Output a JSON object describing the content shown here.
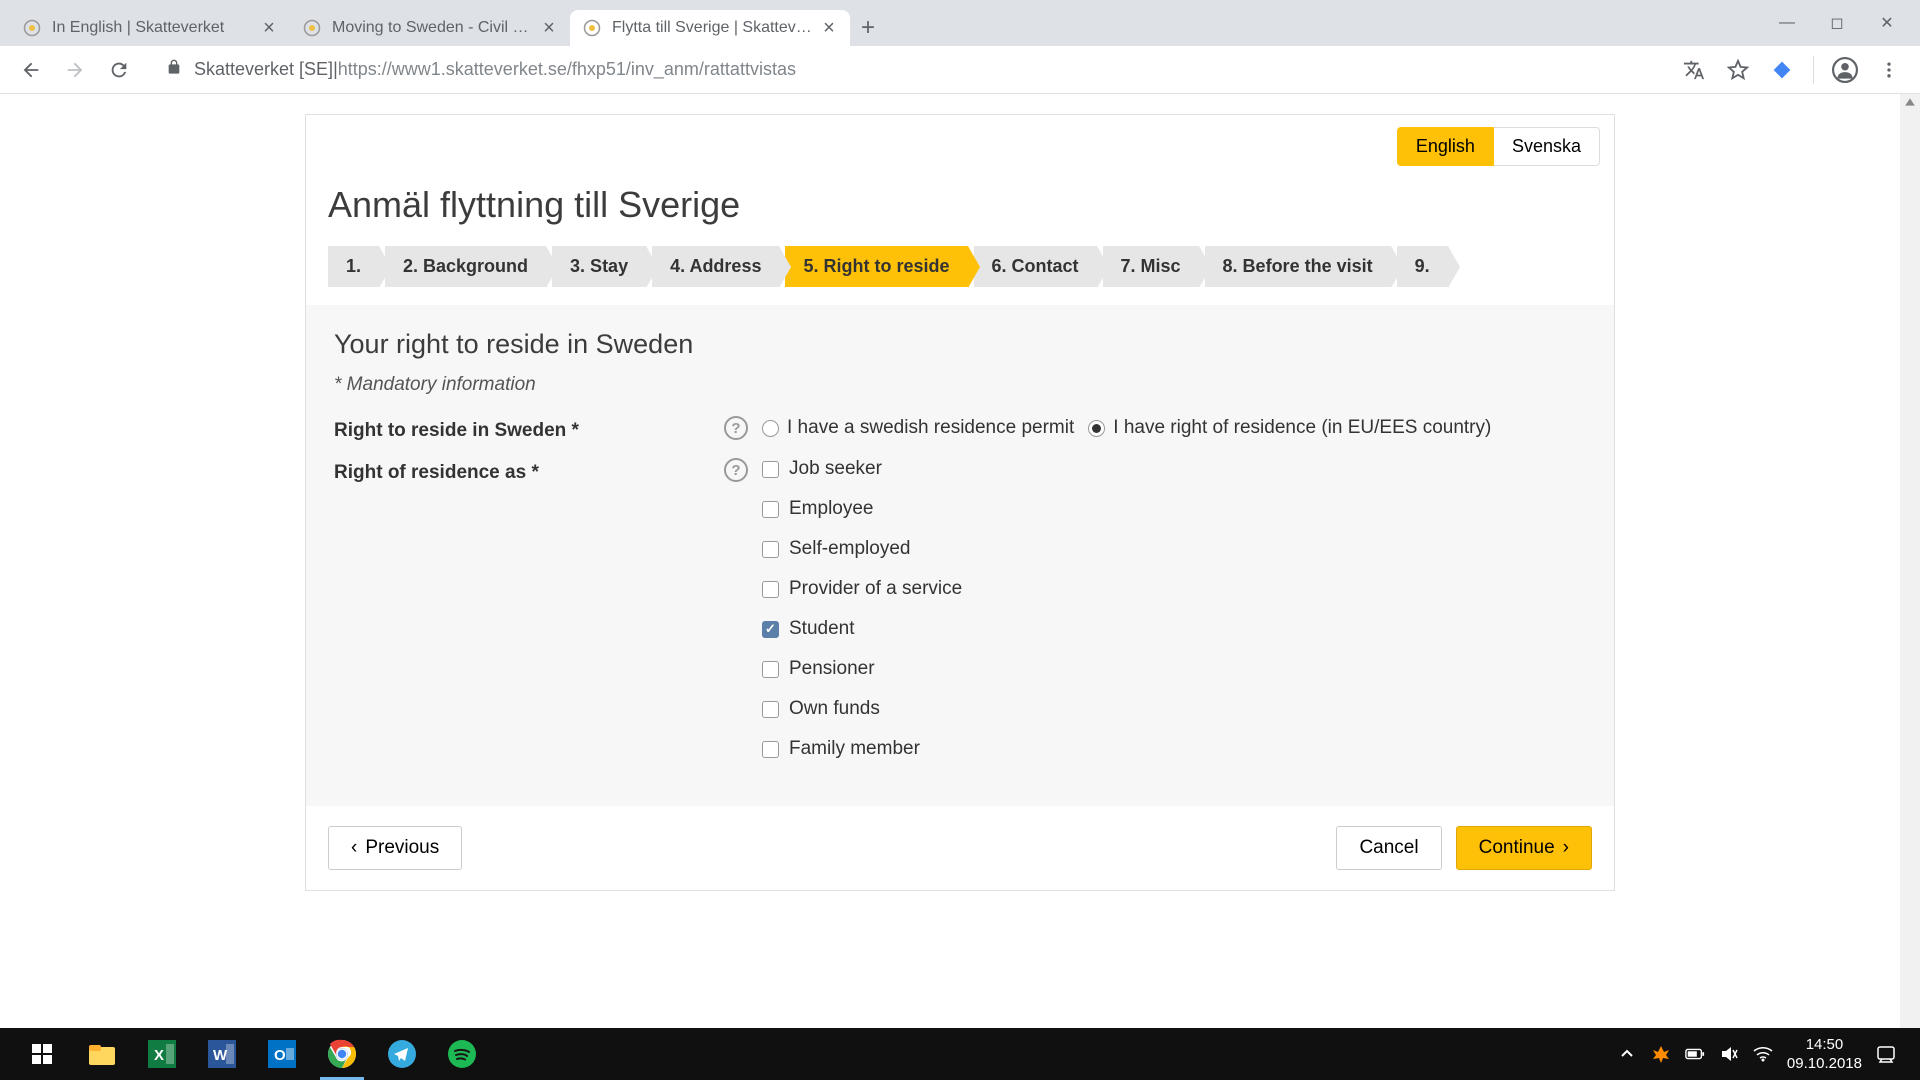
{
  "browser": {
    "tabs": [
      {
        "title": "In English | Skatteverket",
        "active": false
      },
      {
        "title": "Moving to Sweden - Civil registra",
        "active": false
      },
      {
        "title": "Flytta till Sverige | Skatteverket",
        "active": true
      }
    ],
    "url_host": "Skatteverket [SE]",
    "url_sep": " | ",
    "url_full": "https://www1.skatteverket.se/fhxp51/inv_anm/rattattvistas"
  },
  "page": {
    "lang": {
      "english": "English",
      "svenska": "Svenska"
    },
    "title": "Anmäl flyttning till Sverige",
    "steps": [
      "1.",
      "2.  Background",
      "3.  Stay",
      "4.  Address",
      "5.  Right to reside",
      "6.  Contact",
      "7.  Misc",
      "8.  Before the visit",
      "9."
    ],
    "section_title": "Your right to reside in Sweden",
    "mandatory_note": "* Mandatory information",
    "field1": {
      "label": "Right to reside in Sweden *",
      "opt1": "I have a swedish residence permit",
      "opt2": "I have right of residence (in EU/EES country)"
    },
    "field2": {
      "label": "Right of residence as *",
      "options": [
        "Job seeker",
        "Employee",
        "Self-employed",
        "Provider of a service",
        "Student",
        "Pensioner",
        "Own funds",
        "Family member"
      ]
    },
    "buttons": {
      "previous": "Previous",
      "cancel": "Cancel",
      "continue": "Continue"
    }
  },
  "taskbar": {
    "time": "14:50",
    "date": "09.10.2018"
  }
}
